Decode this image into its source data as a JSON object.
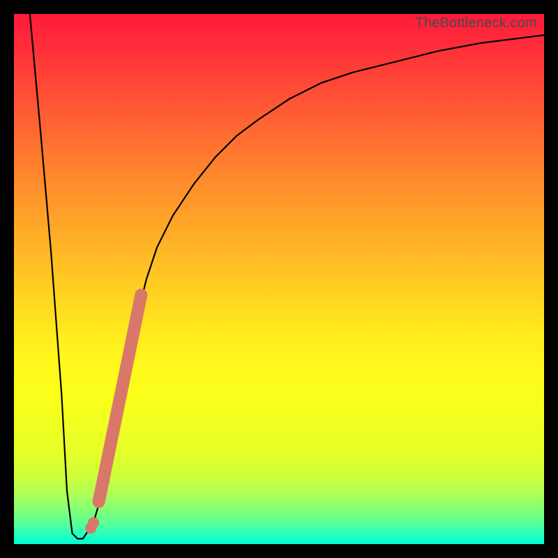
{
  "watermark": "TheBottleneck.com",
  "colors": {
    "frame": "#000000",
    "curve": "#000000",
    "marker": "#d9786a"
  },
  "chart_data": {
    "type": "line",
    "title": "",
    "xlabel": "",
    "ylabel": "",
    "xlim": [
      0,
      100
    ],
    "ylim": [
      0,
      100
    ],
    "grid": false,
    "legend": "none",
    "series": [
      {
        "name": "bottleneck-curve",
        "x": [
          3,
          5,
          7,
          9,
          10,
          11,
          12,
          13,
          15,
          17,
          19,
          21,
          23,
          25,
          27,
          30,
          34,
          38,
          42,
          46,
          52,
          58,
          64,
          72,
          80,
          88,
          96,
          100
        ],
        "y": [
          100,
          78,
          55,
          28,
          10,
          2,
          1,
          1,
          4,
          11,
          21,
          33,
          42,
          50,
          56,
          62,
          68,
          73,
          77,
          80,
          84,
          87,
          89,
          91,
          93,
          94.5,
          95.5,
          96
        ]
      }
    ],
    "accent_segment": {
      "name": "highlighted-range",
      "x": [
        16,
        24
      ],
      "y": [
        8,
        47
      ]
    },
    "markers": [
      {
        "x": 14.5,
        "y": 3.0
      },
      {
        "x": 15.0,
        "y": 4.0
      },
      {
        "x": 17.0,
        "y": 12.0
      },
      {
        "x": 18.0,
        "y": 17.0
      }
    ]
  }
}
